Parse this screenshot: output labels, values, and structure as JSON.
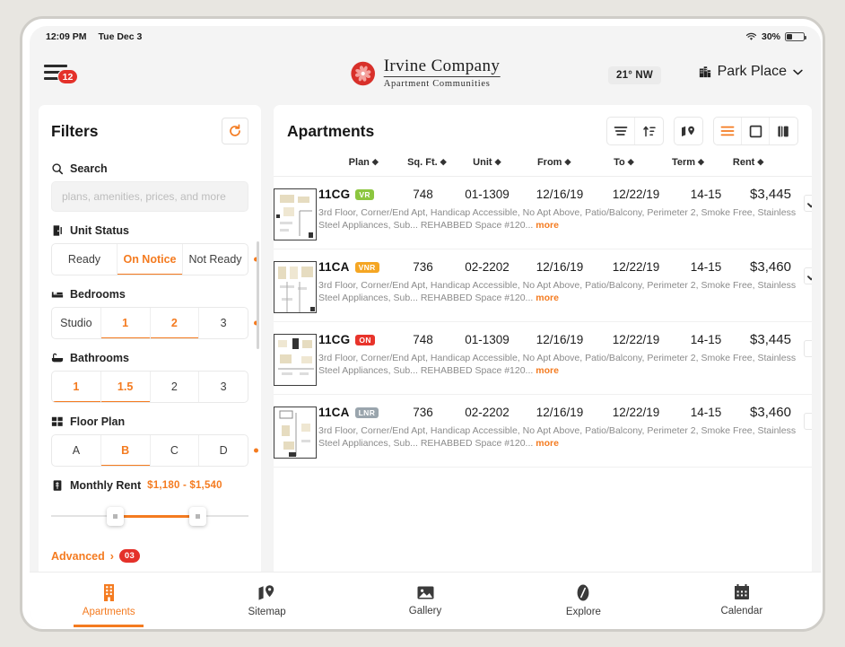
{
  "status_bar": {
    "time": "12:09 PM",
    "date": "Tue Dec 3",
    "battery_percent": "30%",
    "wifi_icon": "wifi-icon",
    "battery_icon": "battery-icon"
  },
  "app_header": {
    "menu_badge": "12",
    "menu_icon": "hamburger-menu-icon",
    "brand_name": "Irvine Company",
    "brand_subtitle": "Apartment Communities",
    "brand_logo_icon": "irvine-company-pinwheel-logo",
    "weather": "21° NW",
    "property": "Park Place",
    "property_icon": "building-icon",
    "property_chevron_icon": "chevron-down-icon"
  },
  "filters": {
    "title": "Filters",
    "reset_icon": "reset-circular-arrow-icon",
    "search": {
      "label": "Search",
      "icon": "search-icon",
      "value": "",
      "placeholder": "plans, amenities, prices, and more"
    },
    "unit_status": {
      "label": "Unit Status",
      "icon": "door-icon",
      "options": [
        "Ready",
        "On Notice",
        "Not Ready"
      ],
      "selected": [
        "On Notice"
      ]
    },
    "bedrooms": {
      "label": "Bedrooms",
      "icon": "bed-icon",
      "options": [
        "Studio",
        "1",
        "2",
        "3"
      ],
      "selected": [
        "1",
        "2"
      ]
    },
    "bathrooms": {
      "label": "Bathrooms",
      "icon": "bathtub-icon",
      "options": [
        "1",
        "1.5",
        "2",
        "3"
      ],
      "selected": [
        "1",
        "1.5"
      ]
    },
    "floor_plan": {
      "label": "Floor Plan",
      "icon": "grid-squares-icon",
      "options": [
        "A",
        "B",
        "C",
        "D"
      ],
      "selected": [
        "B"
      ]
    },
    "monthly_rent": {
      "label": "Monthly Rent",
      "icon": "money-bill-icon",
      "range_text": "$1,180 - $1,540"
    },
    "advanced": {
      "label": "Advanced",
      "chevron": "›",
      "badge": "03"
    }
  },
  "main": {
    "title": "Apartments",
    "toolbar": [
      {
        "name": "list-lines-icon",
        "active": false
      },
      {
        "name": "sort-arrows-icon",
        "active": false
      },
      {
        "name": "map-pin-icon",
        "active": false
      },
      {
        "name": "list-view-icon",
        "active": true
      },
      {
        "name": "card-view-icon",
        "active": false
      },
      {
        "name": "split-view-icon",
        "active": false
      }
    ],
    "columns": [
      "Plan",
      "Sq. Ft.",
      "Unit",
      "From",
      "To",
      "Term",
      "Rent"
    ],
    "rows": [
      {
        "thumbnail": "floor-plan-thumbnail",
        "plan": "11CG",
        "badge": "VR",
        "badge_color": "#8CC63F",
        "sqft": "748",
        "unit": "01-1309",
        "from": "12/16/19",
        "to": "12/22/19",
        "term": "14-15",
        "rent": "$3,445",
        "description": "3rd Floor, Corner/End Apt, Handicap Accessible, No Apt Above, Patio/Balcony, Perimeter 2, Smoke Free, Stainless Steel Appliances, Sub... REHABBED Space #120...",
        "more_label": "more",
        "checked": true
      },
      {
        "thumbnail": "floor-plan-thumbnail",
        "plan": "11CA",
        "badge": "VNR",
        "badge_color": "#F5A623",
        "sqft": "736",
        "unit": "02-2202",
        "from": "12/16/19",
        "to": "12/22/19",
        "term": "14-15",
        "rent": "$3,460",
        "description": "3rd Floor, Corner/End Apt, Handicap Accessible, No Apt Above, Patio/Balcony, Perimeter 2, Smoke Free, Stainless Steel Appliances, Sub... REHABBED Space #120...",
        "more_label": "more",
        "checked": true
      },
      {
        "thumbnail": "floor-plan-thumbnail",
        "plan": "11CG",
        "badge": "ON",
        "badge_color": "#E8342B",
        "sqft": "748",
        "unit": "01-1309",
        "from": "12/16/19",
        "to": "12/22/19",
        "term": "14-15",
        "rent": "$3,445",
        "description": "3rd Floor, Corner/End Apt, Handicap Accessible, No Apt Above, Patio/Balcony, Perimeter 2, Smoke Free, Stainless Steel Appliances, Sub... REHABBED Space #120...",
        "more_label": "more",
        "checked": false
      },
      {
        "thumbnail": "floor-plan-thumbnail",
        "plan": "11CA",
        "badge": "LNR",
        "badge_color": "#9AA5AD",
        "sqft": "736",
        "unit": "02-2202",
        "from": "12/16/19",
        "to": "12/22/19",
        "term": "14-15",
        "rent": "$3,460",
        "description": "3rd Floor, Corner/End Apt, Handicap Accessible, No Apt Above, Patio/Balcony, Perimeter 2, Smoke Free, Stainless Steel Appliances, Sub... REHABBED Space #120...",
        "more_label": "more",
        "checked": false
      }
    ]
  },
  "bottom_nav": {
    "items": [
      {
        "label": "Apartments",
        "icon": "apartment-building-icon",
        "active": true
      },
      {
        "label": "Sitemap",
        "icon": "map-pin-icon",
        "active": false
      },
      {
        "label": "Gallery",
        "icon": "photo-icon",
        "active": false
      },
      {
        "label": "Explore",
        "icon": "compass-icon",
        "active": false
      },
      {
        "label": "Calendar",
        "icon": "calendar-icon",
        "active": false
      }
    ]
  },
  "colors": {
    "accent": "#F47B20",
    "danger": "#E4312A",
    "text": "#1C1C1C",
    "muted": "#8B8B8B"
  }
}
